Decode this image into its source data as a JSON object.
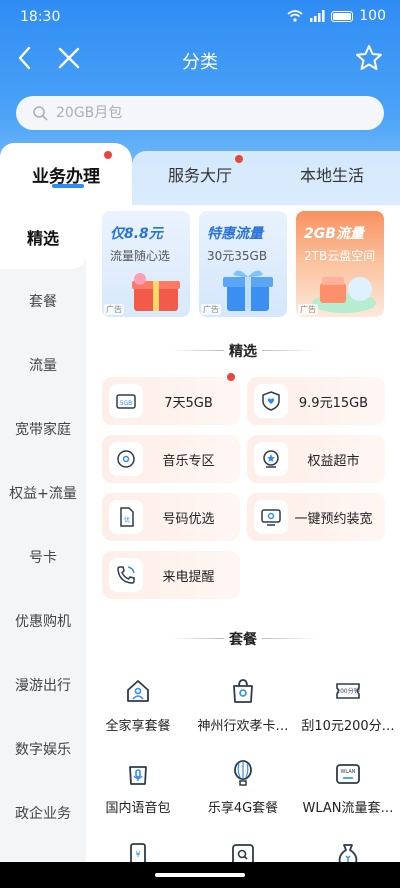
{
  "status": {
    "time": "18:30",
    "battery": "100"
  },
  "nav": {
    "title": "分类"
  },
  "search": {
    "placeholder": "20GB月包"
  },
  "tabs": [
    {
      "label": "业务办理",
      "active": true,
      "dot": true
    },
    {
      "label": "服务大厅",
      "dot": true
    },
    {
      "label": "本地生活"
    }
  ],
  "sidebar": [
    {
      "label": "精选",
      "active": true
    },
    {
      "label": "套餐"
    },
    {
      "label": "流量"
    },
    {
      "label": "宽带家庭"
    },
    {
      "label": "权益+流量"
    },
    {
      "label": "号卡"
    },
    {
      "label": "优惠购机"
    },
    {
      "label": "漫游出行"
    },
    {
      "label": "数字娱乐"
    },
    {
      "label": "政企业务"
    }
  ],
  "banners": [
    {
      "title": "仅8.8元",
      "subtitle": "流量随心选",
      "ad": "广告",
      "bg": "#e6f1fc",
      "title_color": "#2a73d9"
    },
    {
      "title": "特惠流量",
      "subtitle": "30元35GB",
      "ad": "广告",
      "bg": "#e4f0fc",
      "title_color": "#2a73d9"
    },
    {
      "title": "2GB流量",
      "subtitle": "2TB云盘空间",
      "ad": "广告",
      "bg": "#f8a07a",
      "title_color": "#ffffff"
    }
  ],
  "featured": {
    "title": "精选",
    "items": [
      {
        "label": "7天5GB",
        "icon": "5gb-card-icon",
        "dot": true
      },
      {
        "label": "9.9元15GB",
        "icon": "heart-shield-icon"
      },
      {
        "label": "音乐专区",
        "icon": "music-disc-icon"
      },
      {
        "label": "权益超市",
        "icon": "star-box-icon"
      },
      {
        "label": "号码优选",
        "icon": "sim-card-icon"
      },
      {
        "label": "一键预约装宽",
        "icon": "tv-monitor-icon"
      },
      {
        "label": "来电提醒",
        "icon": "phone-ring-icon"
      }
    ]
  },
  "plans": {
    "title": "套餐",
    "items": [
      {
        "label": "全家享套餐",
        "icon": "family-home-icon"
      },
      {
        "label": "神州行欢孝卡…",
        "icon": "gift-bag-icon"
      },
      {
        "label": "刮10元200分…",
        "icon": "ticket-icon"
      },
      {
        "label": "国内语音包",
        "icon": "voice-bag-icon"
      },
      {
        "label": "乐享4G套餐",
        "icon": "balloon-icon"
      },
      {
        "label": "WLAN流量套…",
        "icon": "wlan-box-icon"
      },
      {
        "label": "",
        "icon": "phone-yuan-icon"
      },
      {
        "label": "",
        "icon": "search-bag-icon"
      },
      {
        "label": "",
        "icon": "money-bag-icon"
      }
    ]
  },
  "colors": {
    "primary": "#2f8cf3",
    "dot": "#e9463b",
    "pill_bg": "#fdeee8"
  }
}
